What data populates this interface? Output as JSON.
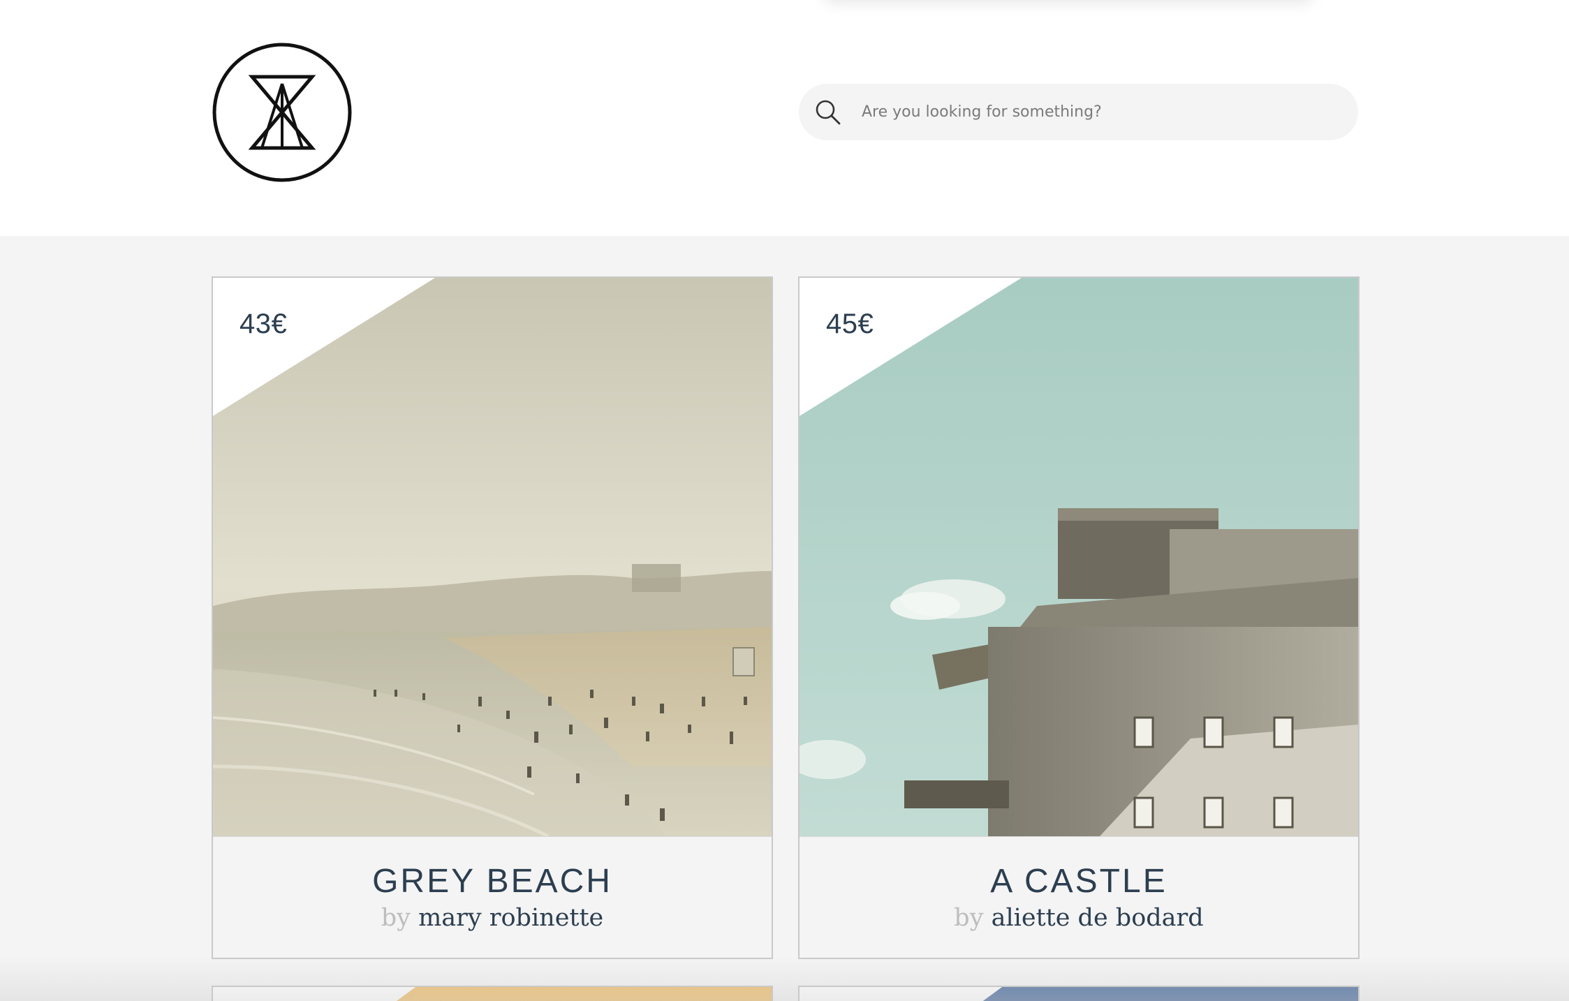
{
  "header": {
    "logo_icon": "hourglass-logo-icon",
    "search": {
      "icon": "search-icon",
      "placeholder": "Are you looking for something?",
      "value": ""
    }
  },
  "products": [
    {
      "price": "43€",
      "title": "GREY BEACH",
      "by": "by",
      "author": "mary robinette",
      "image": "grey-beach-photo"
    },
    {
      "price": "45€",
      "title": "A CASTLE",
      "by": "by",
      "author": "aliette de bodard",
      "image": "castle-photo"
    }
  ],
  "colors": {
    "text": "#2c3e50",
    "muted": "#bdbdbd",
    "page_bg": "#f4f4f4",
    "search_bg": "#f4f4f4"
  }
}
